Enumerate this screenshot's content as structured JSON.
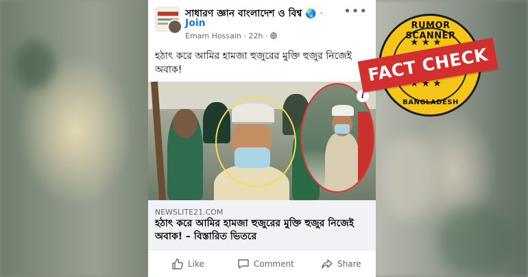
{
  "post": {
    "group_name": "সাধারণ জ্ঞান বাংলাদেশ ও বিশ্ব",
    "join_label": "Join",
    "author": "Emam Hossain",
    "time": "22h",
    "separator": "·",
    "caption": "হঠাৎ করে আমির হামজা হুজুরের মুক্তি হুজুর নিজেই অবাক!",
    "more_icon": "more-options-icon",
    "privacy_icon": "public-globe-icon"
  },
  "link_preview": {
    "domain": "NEWSLITE21.COM",
    "title": "হঠাৎ করে আমির হামজা হুজুরের মুক্তি হুজুর নিজেই অবাক! – বিস্তারিত ভিতরে"
  },
  "photo": {
    "info_label": "i"
  },
  "actions": {
    "like": "Like",
    "comment": "Comment",
    "share": "Share"
  },
  "badge": {
    "top_text": "RUMOR SCANNER",
    "ribbon_text": "FACT CHECK",
    "bottom_text": "BANGLADESH",
    "stars_top": "★★★",
    "stars_bottom": "★★★",
    "colors": {
      "disc": "#f5c518",
      "ribbon": "#d32f2f",
      "ink": "#1a1a1a"
    }
  },
  "colors": {
    "link_blue": "#1b74e4",
    "muted": "#65676b",
    "preview_bg": "#f0f2f5",
    "yellow_circle": "#f2e14a",
    "red_circle": "#e0322f"
  }
}
